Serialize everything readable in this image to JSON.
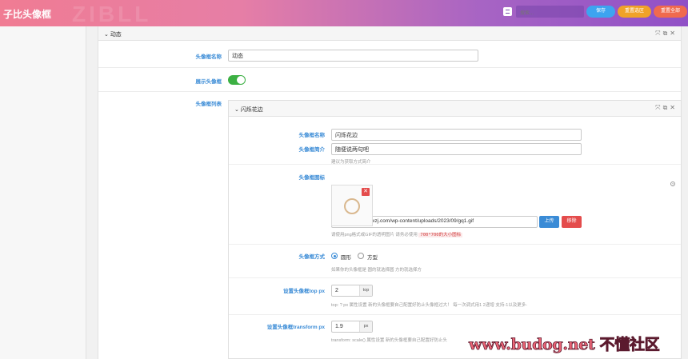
{
  "header": {
    "brand": "子比头像框",
    "watermark": "ZIBLL",
    "search_placeholder": "搜索...",
    "save_label": "保存",
    "reset_section_label": "重置选区",
    "reset_all_label": "重置全部"
  },
  "section": {
    "title": "动态",
    "fields": {
      "name_label": "头像框名称",
      "name_value": "动态",
      "show_label": "展示头像框",
      "show_enabled": true,
      "list_label": "头像框列表"
    }
  },
  "item": {
    "title": "闪烁花边",
    "name_label": "头像框名称",
    "name_value": "闪烁花边",
    "intro_label": "头像框简介",
    "intro_value": "随便说两句吧",
    "intro_note": "建议为获取方式简介",
    "icon_label": "头像框图标",
    "icon_url": "https://demo.bpwzj.com/wp-content/uploads/2023/09/gq1.gif",
    "upload_label": "上传",
    "remove_label": "移除",
    "icon_note": "请使用png格式或GIF的透明图片 请务必使用",
    "icon_note_tag": "700*700的大小图标",
    "style_label": "头像框方式",
    "style_options": [
      "圆形",
      "方型"
    ],
    "style_selected": "圆形",
    "style_note": "如果你的头像框是 圆的就选择圆 方的就选择方",
    "top_label": "设置头像框top px",
    "top_value": "2",
    "top_unit": "top",
    "top_note": "top: ? px 属性设置 新的头像框要自己配置好防止头像框过大！ 每一次调式用1 2递增 支持-1以及更多-",
    "transform_label": "设置头像框transform px",
    "transform_value": "1.9",
    "transform_unit": "px",
    "transform_note": "transform: scale() 属性设置 新的头像框要自己配置好防止头"
  },
  "site_watermark": {
    "domain": "www.budog.net",
    "name": "不懂社区"
  },
  "colors": {
    "accent": "#3a8bd6",
    "save": "#3da4f0",
    "reset_section": "#f0a228",
    "reset_all": "#f06a4e",
    "toggle_on": "#3cb043",
    "danger": "#e44c4c"
  }
}
